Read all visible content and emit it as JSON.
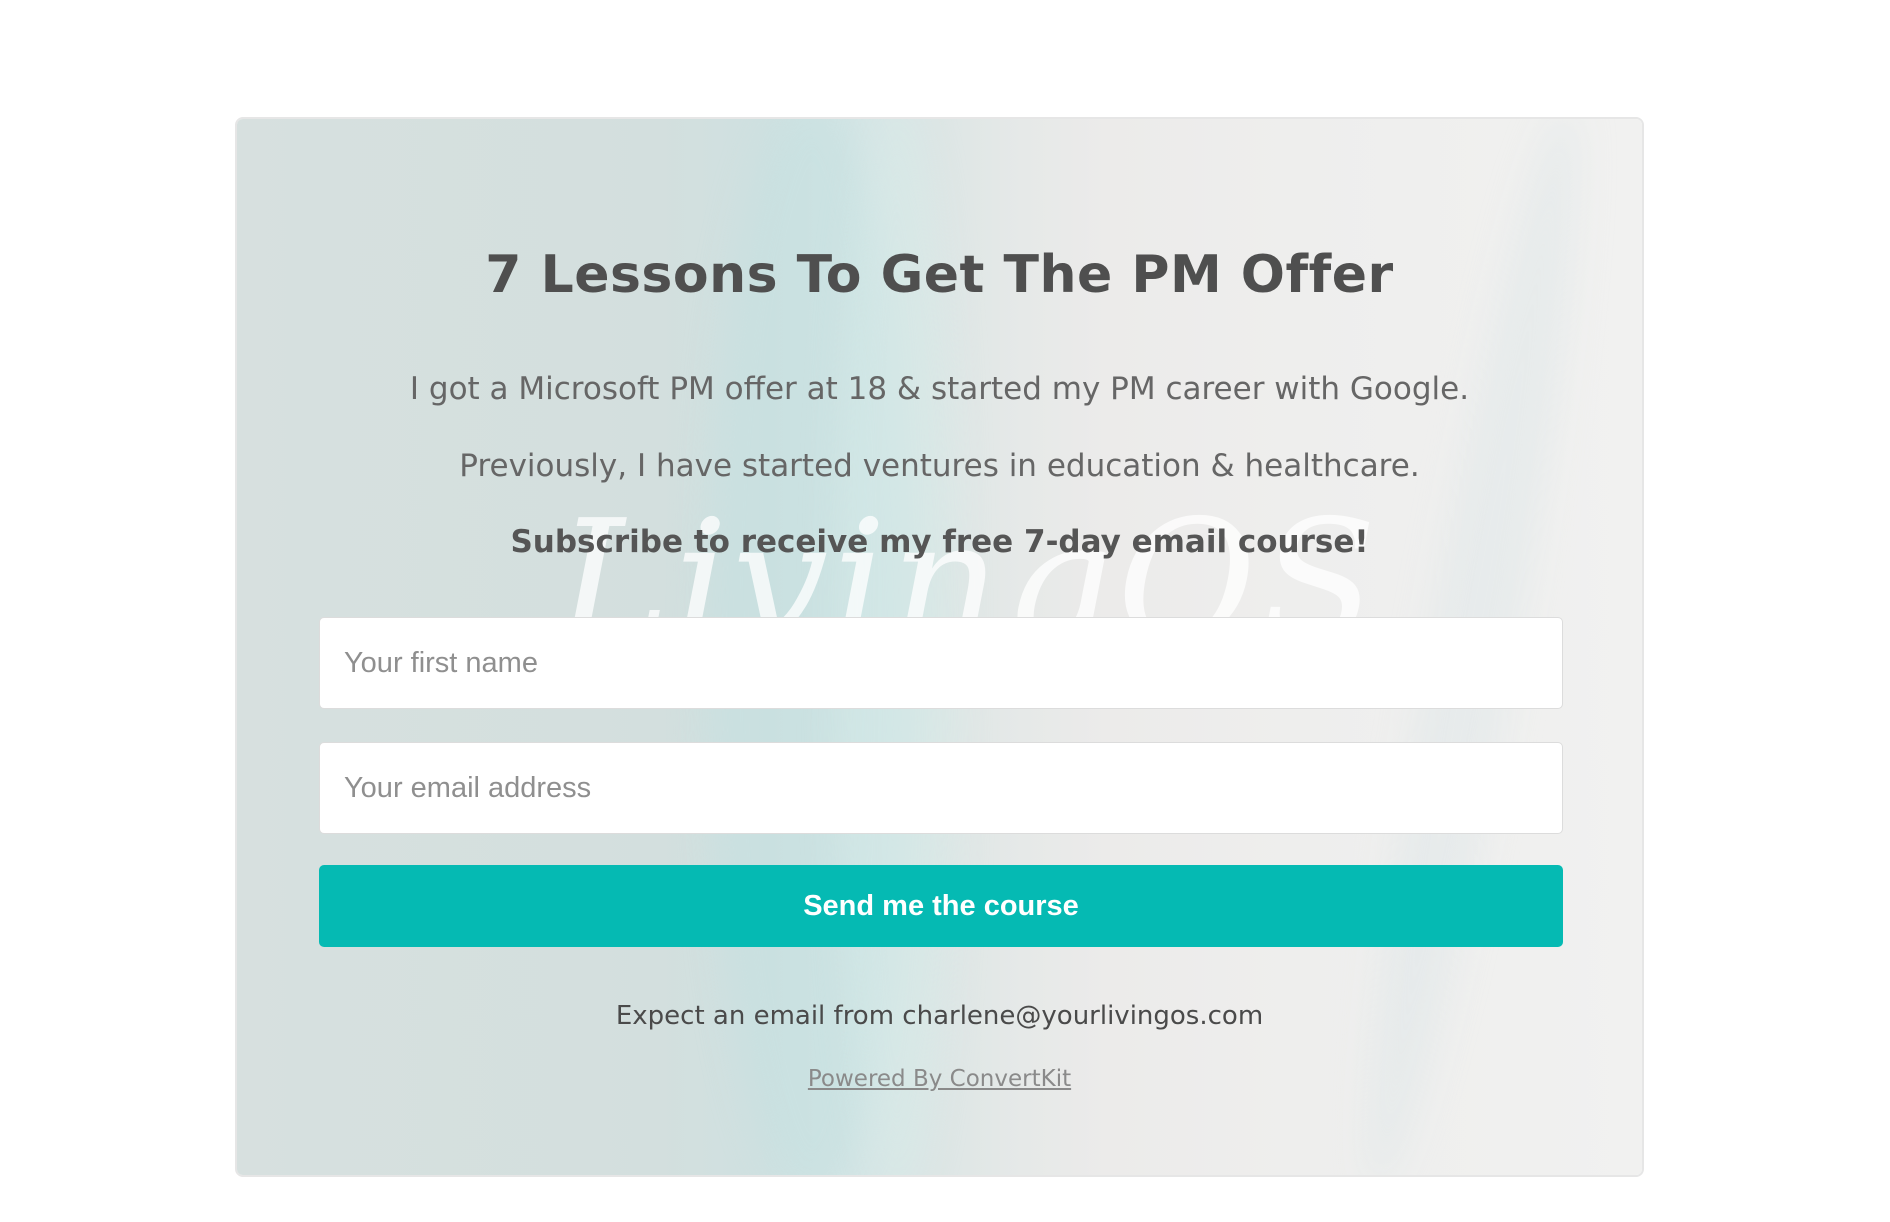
{
  "form": {
    "title": "7 Lessons To Get The PM Offer",
    "paragraph_1": "I got a Microsoft PM offer at 18 & started my PM career with Google.",
    "paragraph_2": "Previously, I have started ventures in education & healthcare.",
    "paragraph_3": "Subscribe to receive my free 7-day email course!",
    "watermark_text": "LivingOS",
    "first_name_placeholder": "Your first name",
    "first_name_value": "",
    "email_placeholder": "Your email address",
    "email_value": "",
    "submit_label": "Send me the course",
    "expect_note": "Expect an email from charlene@yourlivingos.com",
    "powered_by": "Powered By ConvertKit"
  },
  "colors": {
    "accent_button": "#05bab3",
    "title_text": "#4f4f4f",
    "body_text": "#666666"
  }
}
